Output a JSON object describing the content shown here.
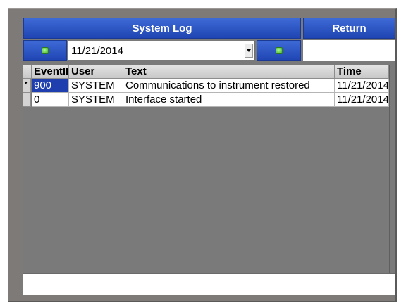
{
  "header": {
    "title": "System Log",
    "return_label": "Return"
  },
  "filter": {
    "date": "11/21/2014"
  },
  "table": {
    "columns": [
      "EventID",
      "User",
      "Text",
      "Time"
    ],
    "rows": [
      {
        "marker": "▸",
        "id": "900",
        "user": "SYSTEM",
        "text": "Communications to instrument restored",
        "time": "11/21/2014"
      },
      {
        "marker": "",
        "id": "0",
        "user": "SYSTEM",
        "text": "Interface started",
        "time": "11/21/2014"
      }
    ]
  },
  "colors": {
    "button_blue": "#2a52c4",
    "selection": "#1f3fae",
    "background": "#7a7a7a"
  },
  "icons": {
    "prev": "green-square-icon",
    "next": "green-square-icon",
    "dropdown": "chevron-down-icon"
  }
}
